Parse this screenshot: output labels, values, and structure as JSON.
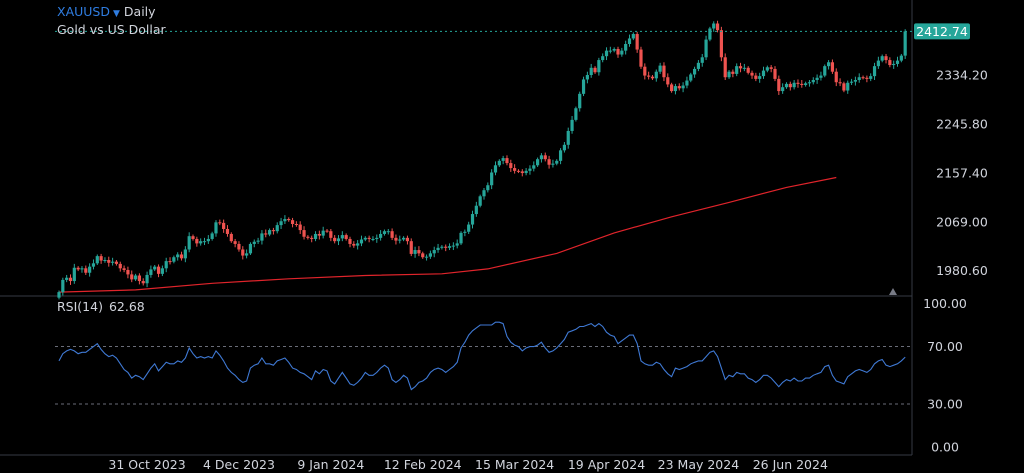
{
  "header": {
    "symbol": "XAUUSD",
    "timeframe": "Daily",
    "description": "Gold vs US Dollar"
  },
  "rsi_panel": {
    "name": "RSI(14)",
    "value": "62.68"
  },
  "colors": {
    "background": "#000000",
    "up": "#26a69a",
    "down": "#ef5350",
    "ma": "#e0242b",
    "rsi": "#3f79d4",
    "grid": "#2a2e39",
    "text": "#d1d4dc",
    "price_tag": "#26a69a"
  },
  "chart_data": [
    {
      "type": "candlestick",
      "title": "XAUUSD Daily",
      "subtitle": "Gold vs US Dollar",
      "last_price": "2412.74",
      "ylim": [
        1935,
        2455
      ],
      "y_ticks": [
        "2334.20",
        "2245.80",
        "2157.40",
        "2069.00",
        "1980.60"
      ],
      "x_ticks": [
        "31 Oct 2023",
        "4 Dec 2023",
        "9 Jan 2024",
        "12 Feb 2024",
        "15 Mar 2024",
        "19 Apr 2024",
        "23 May 2024",
        "26 Jun 2024"
      ],
      "x_tick_index": [
        23,
        47,
        71,
        95,
        119,
        143,
        167,
        191
      ],
      "closes": [
        1942,
        1964,
        1968,
        1962,
        1986,
        1983,
        1985,
        1977,
        1988,
        1994,
        2007,
        1999,
        2000,
        1995,
        1997,
        1993,
        1985,
        1982,
        1974,
        1965,
        1972,
        1962,
        1958,
        1973,
        1983,
        1988,
        1975,
        1985,
        1998,
        1997,
        2005,
        2010,
        2003,
        2019,
        2043,
        2038,
        2030,
        2034,
        2034,
        2038,
        2048,
        2068,
        2067,
        2056,
        2047,
        2034,
        2029,
        2019,
        2008,
        2012,
        2029,
        2033,
        2035,
        2048,
        2046,
        2054,
        2052,
        2063,
        2070,
        2074,
        2072,
        2065,
        2064,
        2054,
        2042,
        2040,
        2038,
        2047,
        2044,
        2053,
        2052,
        2040,
        2034,
        2039,
        2045,
        2038,
        2029,
        2026,
        2030,
        2037,
        2040,
        2038,
        2038,
        2040,
        2047,
        2052,
        2052,
        2040,
        2035,
        2037,
        2040,
        2034,
        2011,
        2018,
        2012,
        2005,
        2006,
        2012,
        2018,
        2022,
        2024,
        2022,
        2025,
        2026,
        2030,
        2049,
        2051,
        2064,
        2083,
        2098,
        2115,
        2126,
        2135,
        2158,
        2171,
        2179,
        2184,
        2175,
        2166,
        2161,
        2160,
        2157,
        2161,
        2165,
        2171,
        2182,
        2189,
        2182,
        2172,
        2174,
        2179,
        2198,
        2208,
        2233,
        2253,
        2274,
        2300,
        2326,
        2334,
        2347,
        2339,
        2361,
        2368,
        2378,
        2378,
        2381,
        2371,
        2378,
        2390,
        2400,
        2408,
        2380,
        2349,
        2333,
        2331,
        2328,
        2340,
        2351,
        2330,
        2317,
        2305,
        2314,
        2310,
        2315,
        2324,
        2335,
        2345,
        2356,
        2366,
        2398,
        2418,
        2427,
        2415,
        2366,
        2330,
        2340,
        2336,
        2350,
        2346,
        2347,
        2338,
        2333,
        2327,
        2332,
        2342,
        2348,
        2345,
        2327,
        2305,
        2312,
        2318,
        2312,
        2320,
        2318,
        2316,
        2319,
        2321,
        2325,
        2329,
        2333,
        2350,
        2357,
        2340,
        2321,
        2319,
        2306,
        2320,
        2322,
        2325,
        2330,
        2329,
        2327,
        2332,
        2350,
        2360,
        2368,
        2361,
        2352,
        2354,
        2360,
        2369,
        2412.74
      ],
      "moving_average": {
        "points": [
          [
            0,
            1942
          ],
          [
            20,
            1946
          ],
          [
            40,
            1958
          ],
          [
            60,
            1966
          ],
          [
            80,
            1972
          ],
          [
            100,
            1975
          ],
          [
            112,
            1984
          ],
          [
            130,
            2012
          ],
          [
            145,
            2049
          ],
          [
            160,
            2078
          ],
          [
            175,
            2104
          ],
          [
            190,
            2131
          ],
          [
            203,
            2149
          ]
        ]
      }
    },
    {
      "type": "line",
      "title": "RSI(14)",
      "last_value": "62.68",
      "ylim": [
        0,
        100
      ],
      "y_ticks": [
        "100.00",
        "70.00",
        "30.00",
        "0.00"
      ],
      "levels": [
        70,
        30
      ],
      "values": [
        60,
        65,
        67,
        68,
        67,
        65,
        66,
        66,
        68,
        70,
        72,
        68,
        65,
        63,
        64,
        62,
        58,
        54,
        52,
        48,
        50,
        49,
        47,
        51,
        55,
        58,
        53,
        56,
        59,
        58,
        58,
        60,
        59,
        62,
        69,
        65,
        62,
        63,
        62,
        63,
        62,
        67,
        64,
        60,
        55,
        52,
        50,
        47,
        45,
        46,
        55,
        57,
        58,
        62,
        58,
        58,
        57,
        60,
        61,
        62,
        59,
        55,
        54,
        52,
        51,
        49,
        47,
        53,
        51,
        54,
        53,
        46,
        44,
        48,
        52,
        48,
        44,
        43,
        45,
        48,
        52,
        50,
        50,
        52,
        55,
        57,
        55,
        47,
        45,
        47,
        50,
        48,
        40,
        42,
        45,
        46,
        48,
        52,
        54,
        55,
        54,
        52,
        54,
        56,
        59,
        69,
        73,
        78,
        81,
        83,
        85,
        85,
        85,
        85,
        87,
        87,
        86,
        77,
        73,
        71,
        70,
        67,
        69,
        70,
        70,
        71,
        73,
        69,
        66,
        67,
        69,
        72,
        75,
        80,
        81,
        82,
        84,
        84,
        85,
        86,
        84,
        86,
        84,
        80,
        78,
        77,
        72,
        74,
        76,
        78,
        78,
        72,
        60,
        58,
        57,
        57,
        59,
        58,
        54,
        51,
        49,
        55,
        54,
        55,
        56,
        58,
        59,
        60,
        60,
        63,
        66,
        67,
        63,
        55,
        47,
        50,
        49,
        52,
        51,
        51,
        48,
        47,
        45,
        47,
        50,
        50,
        48,
        45,
        42,
        45,
        47,
        46,
        48,
        46,
        46,
        48,
        48,
        50,
        51,
        52,
        56,
        57,
        50,
        46,
        45,
        44,
        49,
        51,
        53,
        54,
        53,
        52,
        54,
        58,
        60,
        61,
        57,
        56,
        57,
        58,
        60,
        62.68
      ]
    }
  ]
}
